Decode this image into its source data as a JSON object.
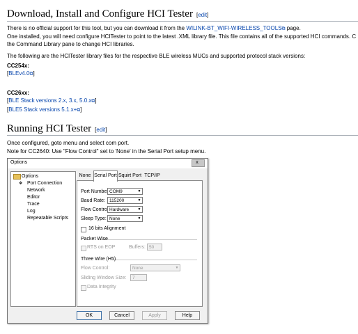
{
  "section1": {
    "heading": "Download, Install and Configure HCI Tester",
    "edit": "edit",
    "para1_before": "There is no official support for this tool, but you can download it from the ",
    "para1_link": "WILINK-BT_WIFI-WIRELESS_TOOLS",
    "para1_after": " page.",
    "para2_line1": "One installed, you will need configure HCITester to point to the latest .XML library file. This file contains all of the supported HCI commands. C",
    "para2_line2": "the Command Library pane to change HCI libraries.",
    "para3": "The following are the HCITester library files for the respective BLE wireless MUCs and supported protocol stack versions:",
    "cc254x_label": "CC254x:",
    "cc254x_link": "BLEv4.0",
    "cc26xx_label": "CC26xx:",
    "cc26xx_links": [
      "BLE Stack versions 2.x, 3.x, 5.0.x",
      "BLE5 Stack versions 5.1.x+"
    ],
    "bracket_open": "[",
    "bracket_close": "]"
  },
  "section2": {
    "heading": "Running HCI Tester",
    "edit": "edit",
    "line1": "Once configured, goto menu and select com port.",
    "line2": "Note for CC2640: Use \"Flow Control\" set to 'None' in the Serial Port setup menu."
  },
  "dialog": {
    "title": "Options",
    "close_glyph": "x",
    "tree": {
      "root": "Options",
      "items": [
        "Port Connection",
        "Network",
        "Editor",
        "Trace",
        "Log",
        "Repeatable Scripts"
      ],
      "selected_arrow": "❖"
    },
    "tabs": [
      "None",
      "Serial Port",
      "Squirt Port",
      "TCP/IP"
    ],
    "serial": {
      "port_number_label": "Port Number:",
      "port_number_value": "COM9",
      "baud_rate_label": "Baud Rate:",
      "baud_rate_value": "115200",
      "flow_control_label": "Flow Control:",
      "flow_control_value": "Hardware",
      "sleep_type_label": "Sleep Type:",
      "sleep_type_value": "None",
      "bits16_label": "16 bits Alignment",
      "packet_wise_label": "Packet Wise",
      "rts_label": "RTS on EOP",
      "buffers_label": "Buffers:",
      "buffers_value": "50",
      "three_wire_label": "Three Wire (H5)",
      "tw_flow_label": "Flow Control:",
      "tw_flow_value": "None",
      "sliding_label": "Sliding Window Size:",
      "sliding_value": "7",
      "data_integrity_label": "Data Integrity",
      "dropdown_glyph": "▼"
    },
    "buttons": {
      "ok": "OK",
      "cancel": "Cancel",
      "apply": "Apply",
      "help": "Help"
    }
  }
}
